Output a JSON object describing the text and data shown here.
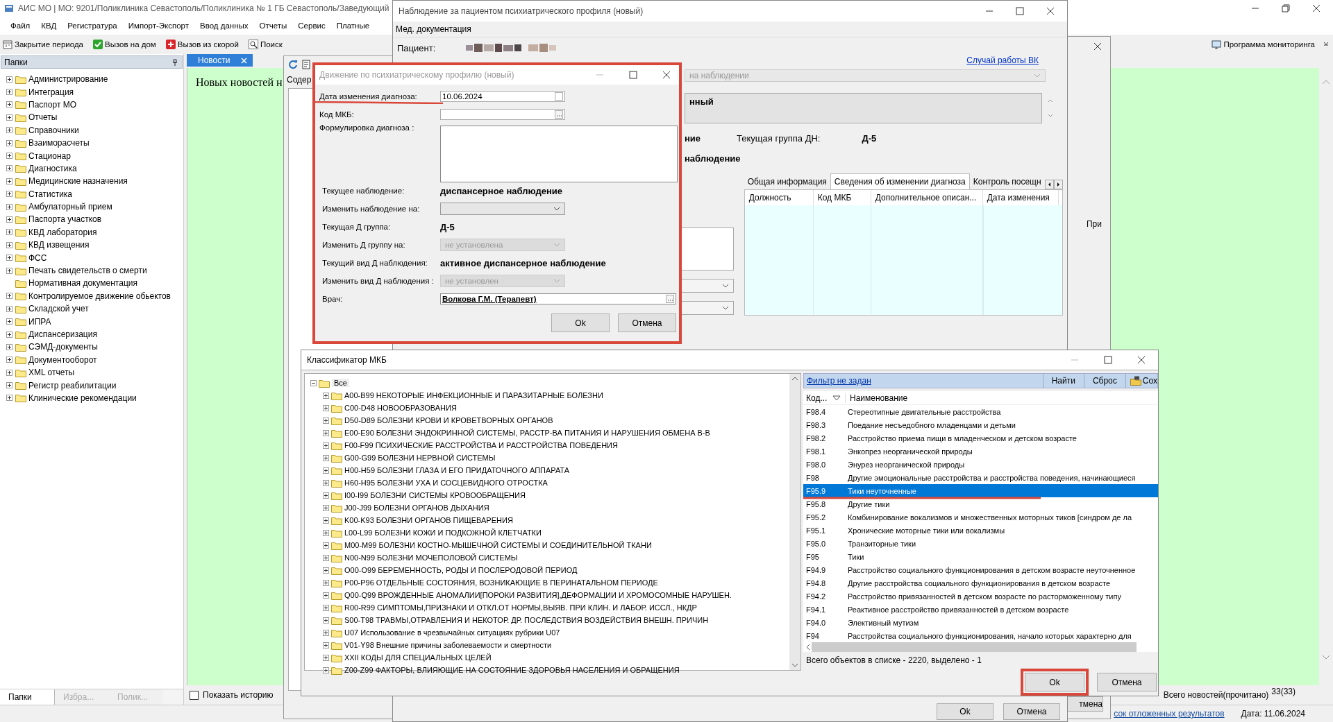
{
  "main_window": {
    "title": "АИС МО | МО: 9201/Поликлиника Севастополь/Поликлиника № 1 ГБ Севастополь/Заведующий",
    "menu": [
      "Файл",
      "КВД",
      "Регистратура",
      "Импорт-Экспорт",
      "Ввод данных",
      "Отчеты",
      "Сервис",
      "Платные"
    ],
    "toolbar": [
      "Закрытие периода",
      "Вызов на дом",
      "Вызов из скорой",
      "Поиск"
    ],
    "toolbar_right": "Программа мониторинга"
  },
  "sidebar": {
    "title": "Папки",
    "items": [
      {
        "label": "Администрирование",
        "expandable": true
      },
      {
        "label": "Интеграция",
        "expandable": true
      },
      {
        "label": "Паспорт МО",
        "expandable": true
      },
      {
        "label": "Отчеты",
        "expandable": true
      },
      {
        "label": "Справочники",
        "expandable": true
      },
      {
        "label": "Взаиморасчеты",
        "expandable": true
      },
      {
        "label": "Стационар",
        "expandable": true
      },
      {
        "label": "Диагностика",
        "expandable": true
      },
      {
        "label": "Медицинские назначения",
        "expandable": true
      },
      {
        "label": "Статистика",
        "expandable": true
      },
      {
        "label": "Амбулаторный прием",
        "expandable": true
      },
      {
        "label": "Паспорта участков",
        "expandable": true
      },
      {
        "label": "КВД лаборатория",
        "expandable": true
      },
      {
        "label": "КВД извещения",
        "expandable": true
      },
      {
        "label": "ФСС",
        "expandable": true
      },
      {
        "label": "Печать свидетельств о смерти",
        "expandable": true
      },
      {
        "label": "Нормативная документация",
        "expandable": false
      },
      {
        "label": "Контролируемое движение обьектов",
        "expandable": true
      },
      {
        "label": "Складской учет",
        "expandable": true
      },
      {
        "label": "ИПРА",
        "expandable": true
      },
      {
        "label": "Диспансеризация",
        "expandable": true
      },
      {
        "label": "СЭМД-документы",
        "expandable": true
      },
      {
        "label": "Документооборот",
        "expandable": true
      },
      {
        "label": "XML отчеты",
        "expandable": true
      },
      {
        "label": "Регистр реабилитации",
        "expandable": true
      },
      {
        "label": "Клинические рекомендации",
        "expandable": true
      }
    ],
    "tabs": [
      {
        "label": "Папки",
        "selected": true
      },
      {
        "label": "Избра...",
        "selected": false
      },
      {
        "label": "Полик...",
        "selected": false
      }
    ]
  },
  "news": {
    "tab": "Новости",
    "text": "Новых новостей н",
    "show_history": {
      "label": "Показать историю",
      "checked": false
    },
    "total_label": "Всего новостей(прочитано)",
    "total": "33(33)"
  },
  "status_bar": {
    "link": "сок отложенных результатов",
    "date": "Дата: 11.06.2024"
  },
  "background_window": {
    "tab": "Содер"
  },
  "right_window": {
    "header": "При",
    "button": "тмена"
  },
  "observation_window": {
    "title": "Наблюдение за пациентом психиатрического профиля (новый)",
    "menu": [
      "Мед. документация"
    ],
    "patient_label": "Пациент:",
    "vk_link": "Случай работы ВК",
    "status_combo": "на наблюдении",
    "diagnosis_text": "нный",
    "label_fragment": "ние",
    "group_label": "Текущая группа ДН:",
    "group_value": "Д-5",
    "observation_fragment": "наблюдение",
    "tabs": [
      {
        "label": "Общая информация",
        "selected": false
      },
      {
        "label": "Сведения об изменении диагноза",
        "selected": true
      },
      {
        "label": "Контроль посещн",
        "selected": false
      }
    ],
    "grid_columns": [
      "Должность",
      "Код МКБ",
      "Дополнительное описан...",
      "Дата изменения"
    ],
    "buttons": [
      "Ok",
      "Отмена"
    ]
  },
  "movement_dialog": {
    "title": "Движение по психиатрическому профилю (новый)",
    "fields": [
      {
        "kind": "date",
        "label": "Дата изменения диагноза:",
        "value": "10.06.2024"
      },
      {
        "kind": "lookup",
        "label": "Код МКБ:"
      },
      {
        "kind": "textarea",
        "label": "Формулировка диагноза :"
      },
      {
        "kind": "text",
        "label": "Текущее наблюдение:",
        "value": "диспансерное наблюдение"
      },
      {
        "kind": "combo",
        "label": "Изменить наблюдение на:",
        "disabled": false
      },
      {
        "kind": "text",
        "label": "Текущая Д группа:",
        "value": "Д-5"
      },
      {
        "kind": "combo",
        "label": "Изменить Д группу на:",
        "disabled": true,
        "value": "не установлена"
      },
      {
        "kind": "text",
        "label": "Текущий вид Д наблюдения:",
        "value": "активное диспансерное наблюдение"
      },
      {
        "kind": "combo",
        "label": "Изменить вид Д наблюдения :",
        "disabled": true,
        "value": "не установлен"
      },
      {
        "kind": "lookup",
        "label": "Врач:",
        "value": "Волкова Г.М. (Терапевт)"
      }
    ],
    "buttons": [
      "Ok",
      "Отмена"
    ]
  },
  "mkb_window": {
    "title": "Классификатор МКБ",
    "tree": {
      "label": "Все",
      "expanded": true,
      "children": [
        {
          "label": "A00-B99 НЕКОТОРЫЕ ИНФЕКЦИОННЫЕ И ПАРАЗИТАРНЫЕ БОЛЕЗНИ",
          "expanded": false
        },
        {
          "label": "C00-D48 НОВООБРАЗОВАНИЯ",
          "expanded": false
        },
        {
          "label": "D50-D89 БОЛЕЗНИ КРОВИ И КРОВЕТВОРНЫХ ОРГАНОВ",
          "expanded": false
        },
        {
          "label": "E00-E90 БОЛЕЗНИ ЭНДОКРИННОЙ СИСТЕМЫ, РАССТР-ВА ПИТАНИЯ И НАРУШЕНИЯ ОБМЕНА В-В",
          "expanded": false
        },
        {
          "label": "F00-F99 ПСИХИЧЕСКИЕ РАССТРОЙСТВА И РАССТРОЙСТВА ПОВЕДЕНИЯ",
          "expanded": false
        },
        {
          "label": "G00-G99 БОЛЕЗНИ НЕРВНОЙ СИСТЕМЫ",
          "expanded": false
        },
        {
          "label": "H00-H59 БОЛЕЗНИ ГЛАЗА И ЕГО ПРИДАТОЧНОГО АППАРАТА",
          "expanded": false
        },
        {
          "label": "H60-H95 БОЛЕЗНИ УХА И СОСЦЕВИДНОГО ОТРОСТКА",
          "expanded": false
        },
        {
          "label": "I00-I99 БОЛЕЗНИ СИСТЕМЫ КРОВООБРАЩЕНИЯ",
          "expanded": false
        },
        {
          "label": "J00-J99 БОЛЕЗНИ ОРГАНОВ ДЫХАНИЯ",
          "expanded": false
        },
        {
          "label": "K00-K93 БОЛЕЗНИ ОРГАНОВ ПИЩЕВАРЕНИЯ",
          "expanded": false
        },
        {
          "label": "L00-L99 БОЛЕЗНИ КОЖИ И ПОДКОЖНОЙ КЛЕТЧАТКИ",
          "expanded": false
        },
        {
          "label": "M00-M99 БОЛЕЗНИ КОСТНО-МЫШЕЧНОЙ СИСТЕМЫ И СОЕДИНИТЕЛЬНОЙ ТКАНИ",
          "expanded": false
        },
        {
          "label": "N00-N99 БОЛЕЗНИ МОЧЕПОЛОВОЙ СИСТЕМЫ",
          "expanded": false
        },
        {
          "label": "O00-O99 БЕРЕМЕННОСТЬ, РОДЫ И ПОСЛЕРОДОВОЙ ПЕРИОД",
          "expanded": false
        },
        {
          "label": "P00-P96 ОТДЕЛЬНЫЕ СОСТОЯНИЯ, ВОЗНИКАЮЩИЕ В ПЕРИНАТАЛЬНОМ ПЕРИОДЕ",
          "expanded": false
        },
        {
          "label": "Q00-Q99 ВРОЖДЕННЫЕ АНОМАЛИИ[ПОРОКИ РАЗВИТИЯ],ДЕФОРМАЦИИ И ХРОМОСОМНЫЕ НАРУШЕН.",
          "expanded": false
        },
        {
          "label": "R00-R99 СИМПТОМЫ,ПРИЗНАКИ И ОТКЛ.ОТ НОРМЫ,ВЫЯВ. ПРИ КЛИН. И ЛАБОР. ИССЛ., НКДР",
          "expanded": false
        },
        {
          "label": "S00-T98 ТРАВМЫ,ОТРАВЛЕНИЯ И НЕКОТОР. ДР. ПОСЛЕДСТВИЯ ВОЗДЕЙСТВИЯ ВНЕШН. ПРИЧИН",
          "expanded": false
        },
        {
          "label": "U07 Использование в чрезвычайных ситуациях рубрики U07",
          "expanded": false
        },
        {
          "label": "V01-Y98 Внешние причины заболеваемости и смертности",
          "expanded": false
        },
        {
          "label": "XXII КОДЫ ДЛЯ СПЕЦИАЛЬНЫХ ЦЕЛЕЙ",
          "expanded": false
        },
        {
          "label": "Z00-Z99 ФАКТОРЫ, ВЛИЯЮЩИЕ НА СОСТОЯНИЕ ЗДОРОВЬЯ НАСЕЛЕНИЯ И ОБРАЩЕНИЯ",
          "expanded": false
        }
      ]
    },
    "filter_link": "Фильтр не задан",
    "toolbar": [
      "Найти",
      "Сброс",
      "Сох"
    ],
    "columns": [
      "Код...",
      "Наименование"
    ],
    "rows": [
      {
        "code": "F98.4",
        "name": "Стереотипные двигательные расстройства",
        "selected": false
      },
      {
        "code": "F98.3",
        "name": "Поедание несъедобного младенцами и детьми",
        "selected": false
      },
      {
        "code": "F98.2",
        "name": "Расстройство приема пищи в младенческом и детском возрасте",
        "selected": false
      },
      {
        "code": "F98.1",
        "name": "Энкопрез неорганической природы",
        "selected": false
      },
      {
        "code": "F98.0",
        "name": "Энурез неорганической природы",
        "selected": false
      },
      {
        "code": "F98",
        "name": "Другие эмоциональные расстройства и расстройства поведения, начинающиеся",
        "selected": false
      },
      {
        "code": "F95.9",
        "name": "Тики неуточненные",
        "selected": true
      },
      {
        "code": "F95.8",
        "name": "Другие тики",
        "selected": false
      },
      {
        "code": "F95.2",
        "name": "Комбинирование вокализмов и множественных моторных тиков [синдром де ла",
        "selected": false
      },
      {
        "code": "F95.1",
        "name": "Хронические моторные тики или вокализмы",
        "selected": false
      },
      {
        "code": "F95.0",
        "name": "Транзиторные тики",
        "selected": false
      },
      {
        "code": "F95",
        "name": "Тики",
        "selected": false
      },
      {
        "code": "F94.9",
        "name": "Расстройство социального функционирования в детском возрасте неуточненное",
        "selected": false
      },
      {
        "code": "F94.8",
        "name": "Другие расстройства социального функционирования в детском возрасте",
        "selected": false
      },
      {
        "code": "F94.2",
        "name": "Расстройство привязанностей в детском возрасте по расторможенному типу",
        "selected": false
      },
      {
        "code": "F94.1",
        "name": "Реактивное расстройство привязанностей в детском возрасте",
        "selected": false
      },
      {
        "code": "F94.0",
        "name": "Элективный мутизм",
        "selected": false
      },
      {
        "code": "F94",
        "name": "Расстройства социального функционирования, начало которых характерно для",
        "selected": false
      }
    ],
    "footer": "Всего объектов в списке - 2220, выделено - 1",
    "buttons": [
      "Ok",
      "Отмена"
    ]
  }
}
